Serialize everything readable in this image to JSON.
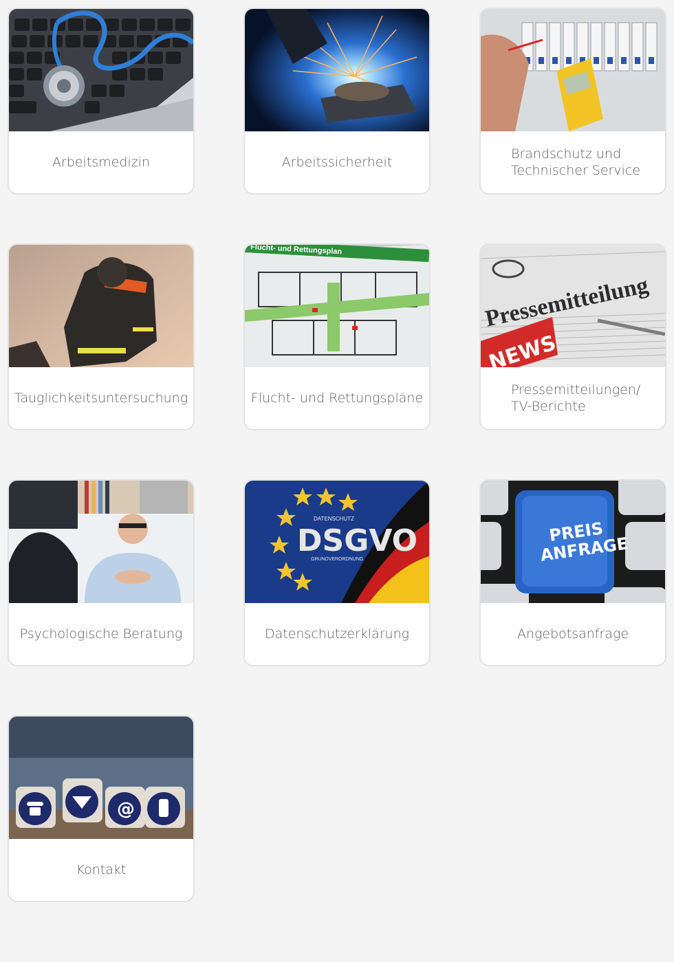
{
  "tiles": [
    {
      "label": "Arbeitsmedizin",
      "image": "stethoscope-on-keyboard-image"
    },
    {
      "label": "Arbeitssicherheit",
      "image": "welding-sparks-image"
    },
    {
      "label": "Brandschutz und\nTechnischer Service",
      "image": "electrician-multimeter-image"
    },
    {
      "label": "Tauglichkeitsuntersuchung",
      "image": "firefighter-image"
    },
    {
      "label": "Flucht- und Rettungspläne",
      "image": "escape-plan-image",
      "image_text": "Flucht- und Rettungsplan"
    },
    {
      "label": "Pressemitteilungen/\nTV-Berichte",
      "image": "newspaper-news-image",
      "image_text": [
        "Pressemitteilung",
        "NEWS"
      ]
    },
    {
      "label": "Psychologische Beratung",
      "image": "counseling-session-image"
    },
    {
      "label": "Datenschutzerklärung",
      "image": "gdpr-flag-image",
      "image_text": [
        "DATENSCHUTZ",
        "DSGVO",
        "GRUNDVERORDNUNG"
      ]
    },
    {
      "label": "Angebotsanfrage",
      "image": "price-request-key-image",
      "image_text": [
        "PREIS",
        "ANFRAGE"
      ]
    },
    {
      "label": "Kontakt",
      "image": "contact-dice-image"
    }
  ],
  "colors": {
    "page_background": "#f4f4f4",
    "tile_background": "#ffffff",
    "tile_border": "#e2e2e2",
    "label_text": "#5f5f5f"
  }
}
